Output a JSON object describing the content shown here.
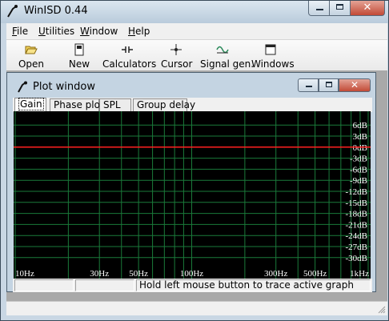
{
  "app": {
    "title": "WinISD 0.44"
  },
  "menu": [
    {
      "pre": "",
      "u": "F",
      "post": "ile"
    },
    {
      "pre": "",
      "u": "U",
      "post": "tilities"
    },
    {
      "pre": "",
      "u": "W",
      "post": "indow"
    },
    {
      "pre": "",
      "u": "H",
      "post": "elp"
    }
  ],
  "toolbar": {
    "open": "Open",
    "new": "New",
    "calculators": "Calculators",
    "cursor": "Cursor",
    "signal_gen": "Signal gen.",
    "windows": "Windows"
  },
  "plot_window": {
    "title": "Plot window",
    "tabs": [
      "Gain",
      "Phase plot",
      "SPL",
      "Group delay"
    ],
    "active_tab": "Gain",
    "status_hint": "Hold left mouse button to trace active graph"
  },
  "chart_data": {
    "type": "line",
    "x_scale": "log",
    "xlim": [
      10,
      1000
    ],
    "ylim": [
      -32,
      8
    ],
    "x_ticks": [
      {
        "value": 10,
        "label": "10Hz"
      },
      {
        "value": 30,
        "label": "30Hz"
      },
      {
        "value": 50,
        "label": "50Hz"
      },
      {
        "value": 100,
        "label": "100Hz"
      },
      {
        "value": 300,
        "label": "300Hz"
      },
      {
        "value": 500,
        "label": "500Hz"
      },
      {
        "value": 1000,
        "label": "1kHz"
      }
    ],
    "y_ticks": [
      {
        "value": 6,
        "label": "6dB"
      },
      {
        "value": 3,
        "label": "3dB"
      },
      {
        "value": 0,
        "label": "0dB"
      },
      {
        "value": -3,
        "label": "-3dB"
      },
      {
        "value": -6,
        "label": "-6dB"
      },
      {
        "value": -9,
        "label": "-9dB"
      },
      {
        "value": -12,
        "label": "-12dB"
      },
      {
        "value": -15,
        "label": "-15dB"
      },
      {
        "value": -18,
        "label": "-18dB"
      },
      {
        "value": -21,
        "label": "-21dB"
      },
      {
        "value": -24,
        "label": "-24dB"
      },
      {
        "value": -27,
        "label": "-27dB"
      },
      {
        "value": -30,
        "label": "-30dB"
      }
    ],
    "reference_line": {
      "value": 0,
      "color": "#ff2020"
    },
    "grid": true,
    "grid_color": "#1a7a3a",
    "background": "#000000",
    "label_color": "#ffffff",
    "series": []
  }
}
